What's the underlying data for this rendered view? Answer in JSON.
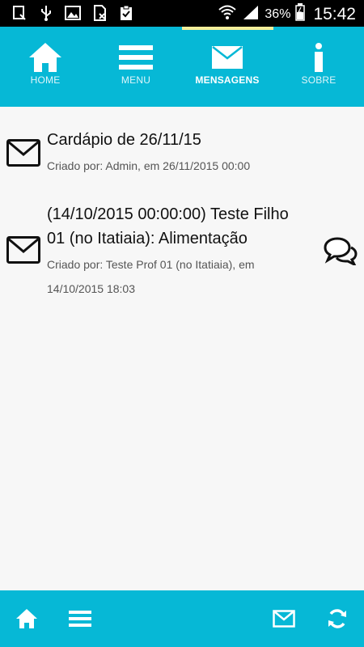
{
  "status_bar": {
    "battery": "36%",
    "time": "15:42"
  },
  "nav": {
    "tabs": [
      {
        "label": "HOME",
        "icon": "home-icon",
        "active": false
      },
      {
        "label": "MENU",
        "icon": "menu-icon",
        "active": false
      },
      {
        "label": "MENSAGENS",
        "icon": "envelope-icon",
        "active": true
      },
      {
        "label": "SOBRE",
        "icon": "info-icon",
        "active": false
      }
    ]
  },
  "messages": [
    {
      "title": "Cardápio de 26/11/15",
      "meta": "Criado por: Admin, em 26/11/2015 00:00",
      "has_comments": false
    },
    {
      "title_line1": "(14/10/2015 00:00:00) Teste Filho",
      "title_line2": "01 (no Itatiaia): Alimentação",
      "meta_line1": "Criado por: Teste Prof 01 (no Itatiaia), em",
      "meta_line2": "14/10/2015 18:03",
      "has_comments": true
    }
  ],
  "bottom_bar": {
    "buttons": [
      "home-icon",
      "menu-icon",
      "envelope-icon",
      "refresh-icon"
    ]
  },
  "colors": {
    "primary": "#06b8d6",
    "indicator": "#f3ee9a",
    "background": "#f7f7f7"
  }
}
